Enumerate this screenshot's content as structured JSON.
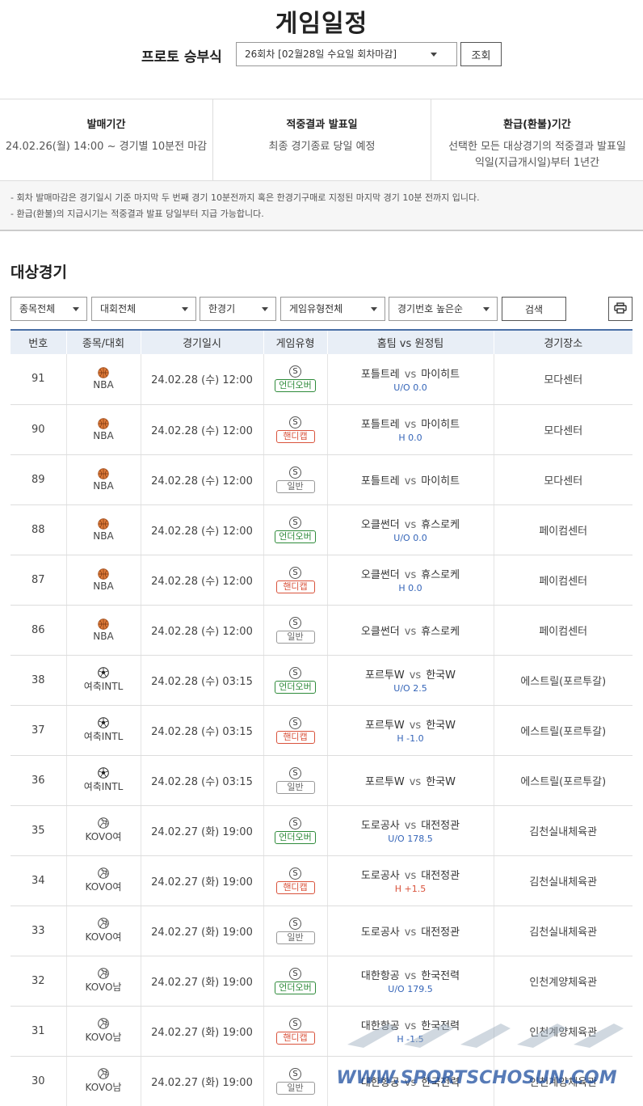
{
  "page": {
    "title": "게임일정"
  },
  "round": {
    "label": "프로토 승부식",
    "selected": "26회차 [02월28일 수요일 회차마감]",
    "button": "조회"
  },
  "info": [
    {
      "heading": "발매기간",
      "lines": [
        "24.02.26(월) 14:00 ~ 경기별 10분전 마감"
      ]
    },
    {
      "heading": "적중결과 발표일",
      "lines": [
        "최종 경기종료 당일 예정"
      ]
    },
    {
      "heading": "환급(환불)기간",
      "lines": [
        "선택한 모든 대상경기의 적중결과 발표일",
        "익일(지급개시일)부터 1년간"
      ]
    }
  ],
  "notes": [
    "- 회차 발매마감은 경기일시 기준 마지막 두 번째 경기 10분전까지 혹은 한경기구매로 지정된 마지막 경기 10분 전까지 입니다.",
    "- 환급(환불)의 지급시기는 적중결과 발표 당일부터 지급 가능합니다."
  ],
  "section": {
    "title": "대상경기"
  },
  "filters": {
    "sport": "종목전체",
    "league": "대회전체",
    "single": "한경기",
    "type": "게임유형전체",
    "sort": "경기번호 높은순",
    "search": "검색"
  },
  "columns": [
    "번호",
    "종목/대회",
    "경기일시",
    "게임유형",
    "홈팀 vs 원정팀",
    "경기장소"
  ],
  "vs": "vs",
  "s_mark": "S",
  "icons": {
    "print": "printer-icon",
    "basketball": "basketball-icon",
    "soccer": "soccer-ball-icon",
    "volleyball": "volleyball-icon"
  },
  "colors": {
    "header_bg": "#e8eef6",
    "header_border": "#4a6fa5",
    "over_under": "#2e8b3a",
    "handicap": "#d9533c",
    "handi_value_blue": "#3565b8"
  },
  "rows": [
    {
      "no": "91",
      "sport": "basketball",
      "league": "NBA",
      "datetime": "24.02.28 (수) 12:00",
      "type": "언더오버",
      "home": "포틀트레",
      "away": "마이히트",
      "handi": "U/O 0.0",
      "handi_red": false,
      "venue": "모다센터"
    },
    {
      "no": "90",
      "sport": "basketball",
      "league": "NBA",
      "datetime": "24.02.28 (수) 12:00",
      "type": "핸디캡",
      "home": "포틀트레",
      "away": "마이히트",
      "handi": "H 0.0",
      "handi_red": false,
      "venue": "모다센터"
    },
    {
      "no": "89",
      "sport": "basketball",
      "league": "NBA",
      "datetime": "24.02.28 (수) 12:00",
      "type": "일반",
      "home": "포틀트레",
      "away": "마이히트",
      "handi": "",
      "handi_red": false,
      "venue": "모다센터"
    },
    {
      "no": "88",
      "sport": "basketball",
      "league": "NBA",
      "datetime": "24.02.28 (수) 12:00",
      "type": "언더오버",
      "home": "오클썬더",
      "away": "휴스로케",
      "handi": "U/O 0.0",
      "handi_red": false,
      "venue": "페이컴센터"
    },
    {
      "no": "87",
      "sport": "basketball",
      "league": "NBA",
      "datetime": "24.02.28 (수) 12:00",
      "type": "핸디캡",
      "home": "오클썬더",
      "away": "휴스로케",
      "handi": "H 0.0",
      "handi_red": false,
      "venue": "페이컴센터"
    },
    {
      "no": "86",
      "sport": "basketball",
      "league": "NBA",
      "datetime": "24.02.28 (수) 12:00",
      "type": "일반",
      "home": "오클썬더",
      "away": "휴스로케",
      "handi": "",
      "handi_red": false,
      "venue": "페이컴센터"
    },
    {
      "no": "38",
      "sport": "soccer",
      "league": "여축INTL",
      "datetime": "24.02.28 (수) 03:15",
      "type": "언더오버",
      "home": "포르투W",
      "away": "한국W",
      "handi": "U/O 2.5",
      "handi_red": false,
      "venue": "에스트릴(포르투갈)"
    },
    {
      "no": "37",
      "sport": "soccer",
      "league": "여축INTL",
      "datetime": "24.02.28 (수) 03:15",
      "type": "핸디캡",
      "home": "포르투W",
      "away": "한국W",
      "handi": "H -1.0",
      "handi_red": false,
      "venue": "에스트릴(포르투갈)"
    },
    {
      "no": "36",
      "sport": "soccer",
      "league": "여축INTL",
      "datetime": "24.02.28 (수) 03:15",
      "type": "일반",
      "home": "포르투W",
      "away": "한국W",
      "handi": "",
      "handi_red": false,
      "venue": "에스트릴(포르투갈)"
    },
    {
      "no": "35",
      "sport": "volleyball",
      "league": "KOVO여",
      "datetime": "24.02.27 (화) 19:00",
      "type": "언더오버",
      "home": "도로공사",
      "away": "대전정관",
      "handi": "U/O 178.5",
      "handi_red": false,
      "venue": "김천실내체육관"
    },
    {
      "no": "34",
      "sport": "volleyball",
      "league": "KOVO여",
      "datetime": "24.02.27 (화) 19:00",
      "type": "핸디캡",
      "home": "도로공사",
      "away": "대전정관",
      "handi": "H +1.5",
      "handi_red": true,
      "venue": "김천실내체육관"
    },
    {
      "no": "33",
      "sport": "volleyball",
      "league": "KOVO여",
      "datetime": "24.02.27 (화) 19:00",
      "type": "일반",
      "home": "도로공사",
      "away": "대전정관",
      "handi": "",
      "handi_red": false,
      "venue": "김천실내체육관"
    },
    {
      "no": "32",
      "sport": "volleyball",
      "league": "KOVO남",
      "datetime": "24.02.27 (화) 19:00",
      "type": "언더오버",
      "home": "대한항공",
      "away": "한국전력",
      "handi": "U/O 179.5",
      "handi_red": false,
      "venue": "인천계양체육관"
    },
    {
      "no": "31",
      "sport": "volleyball",
      "league": "KOVO남",
      "datetime": "24.02.27 (화) 19:00",
      "type": "핸디캡",
      "home": "대한항공",
      "away": "한국전력",
      "handi": "H -1.5",
      "handi_red": false,
      "venue": "인천계양체육관"
    },
    {
      "no": "30",
      "sport": "volleyball",
      "league": "KOVO남",
      "datetime": "24.02.27 (화) 19:00",
      "type": "일반",
      "home": "대한항공",
      "away": "한국전력",
      "handi": "",
      "handi_red": false,
      "venue": "인천계양체육관"
    }
  ],
  "watermark": {
    "text": "WWW.SPORTSCHOSUN.COM"
  }
}
